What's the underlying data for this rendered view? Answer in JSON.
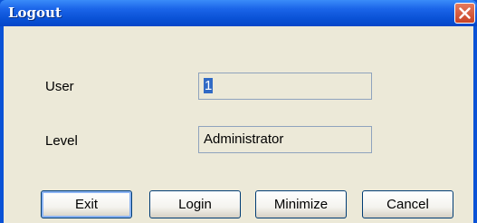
{
  "window": {
    "title": "Logout"
  },
  "form": {
    "user_label": "User",
    "user_value": "1",
    "level_label": "Level",
    "level_value": "Administrator"
  },
  "buttons": {
    "exit": "Exit",
    "login": "Login",
    "minimize": "Minimize",
    "cancel": "Cancel"
  },
  "colors": {
    "titlebar": "#0a52d6",
    "client": "#ece9d8",
    "close": "#c84326",
    "selection": "#316ac5"
  }
}
